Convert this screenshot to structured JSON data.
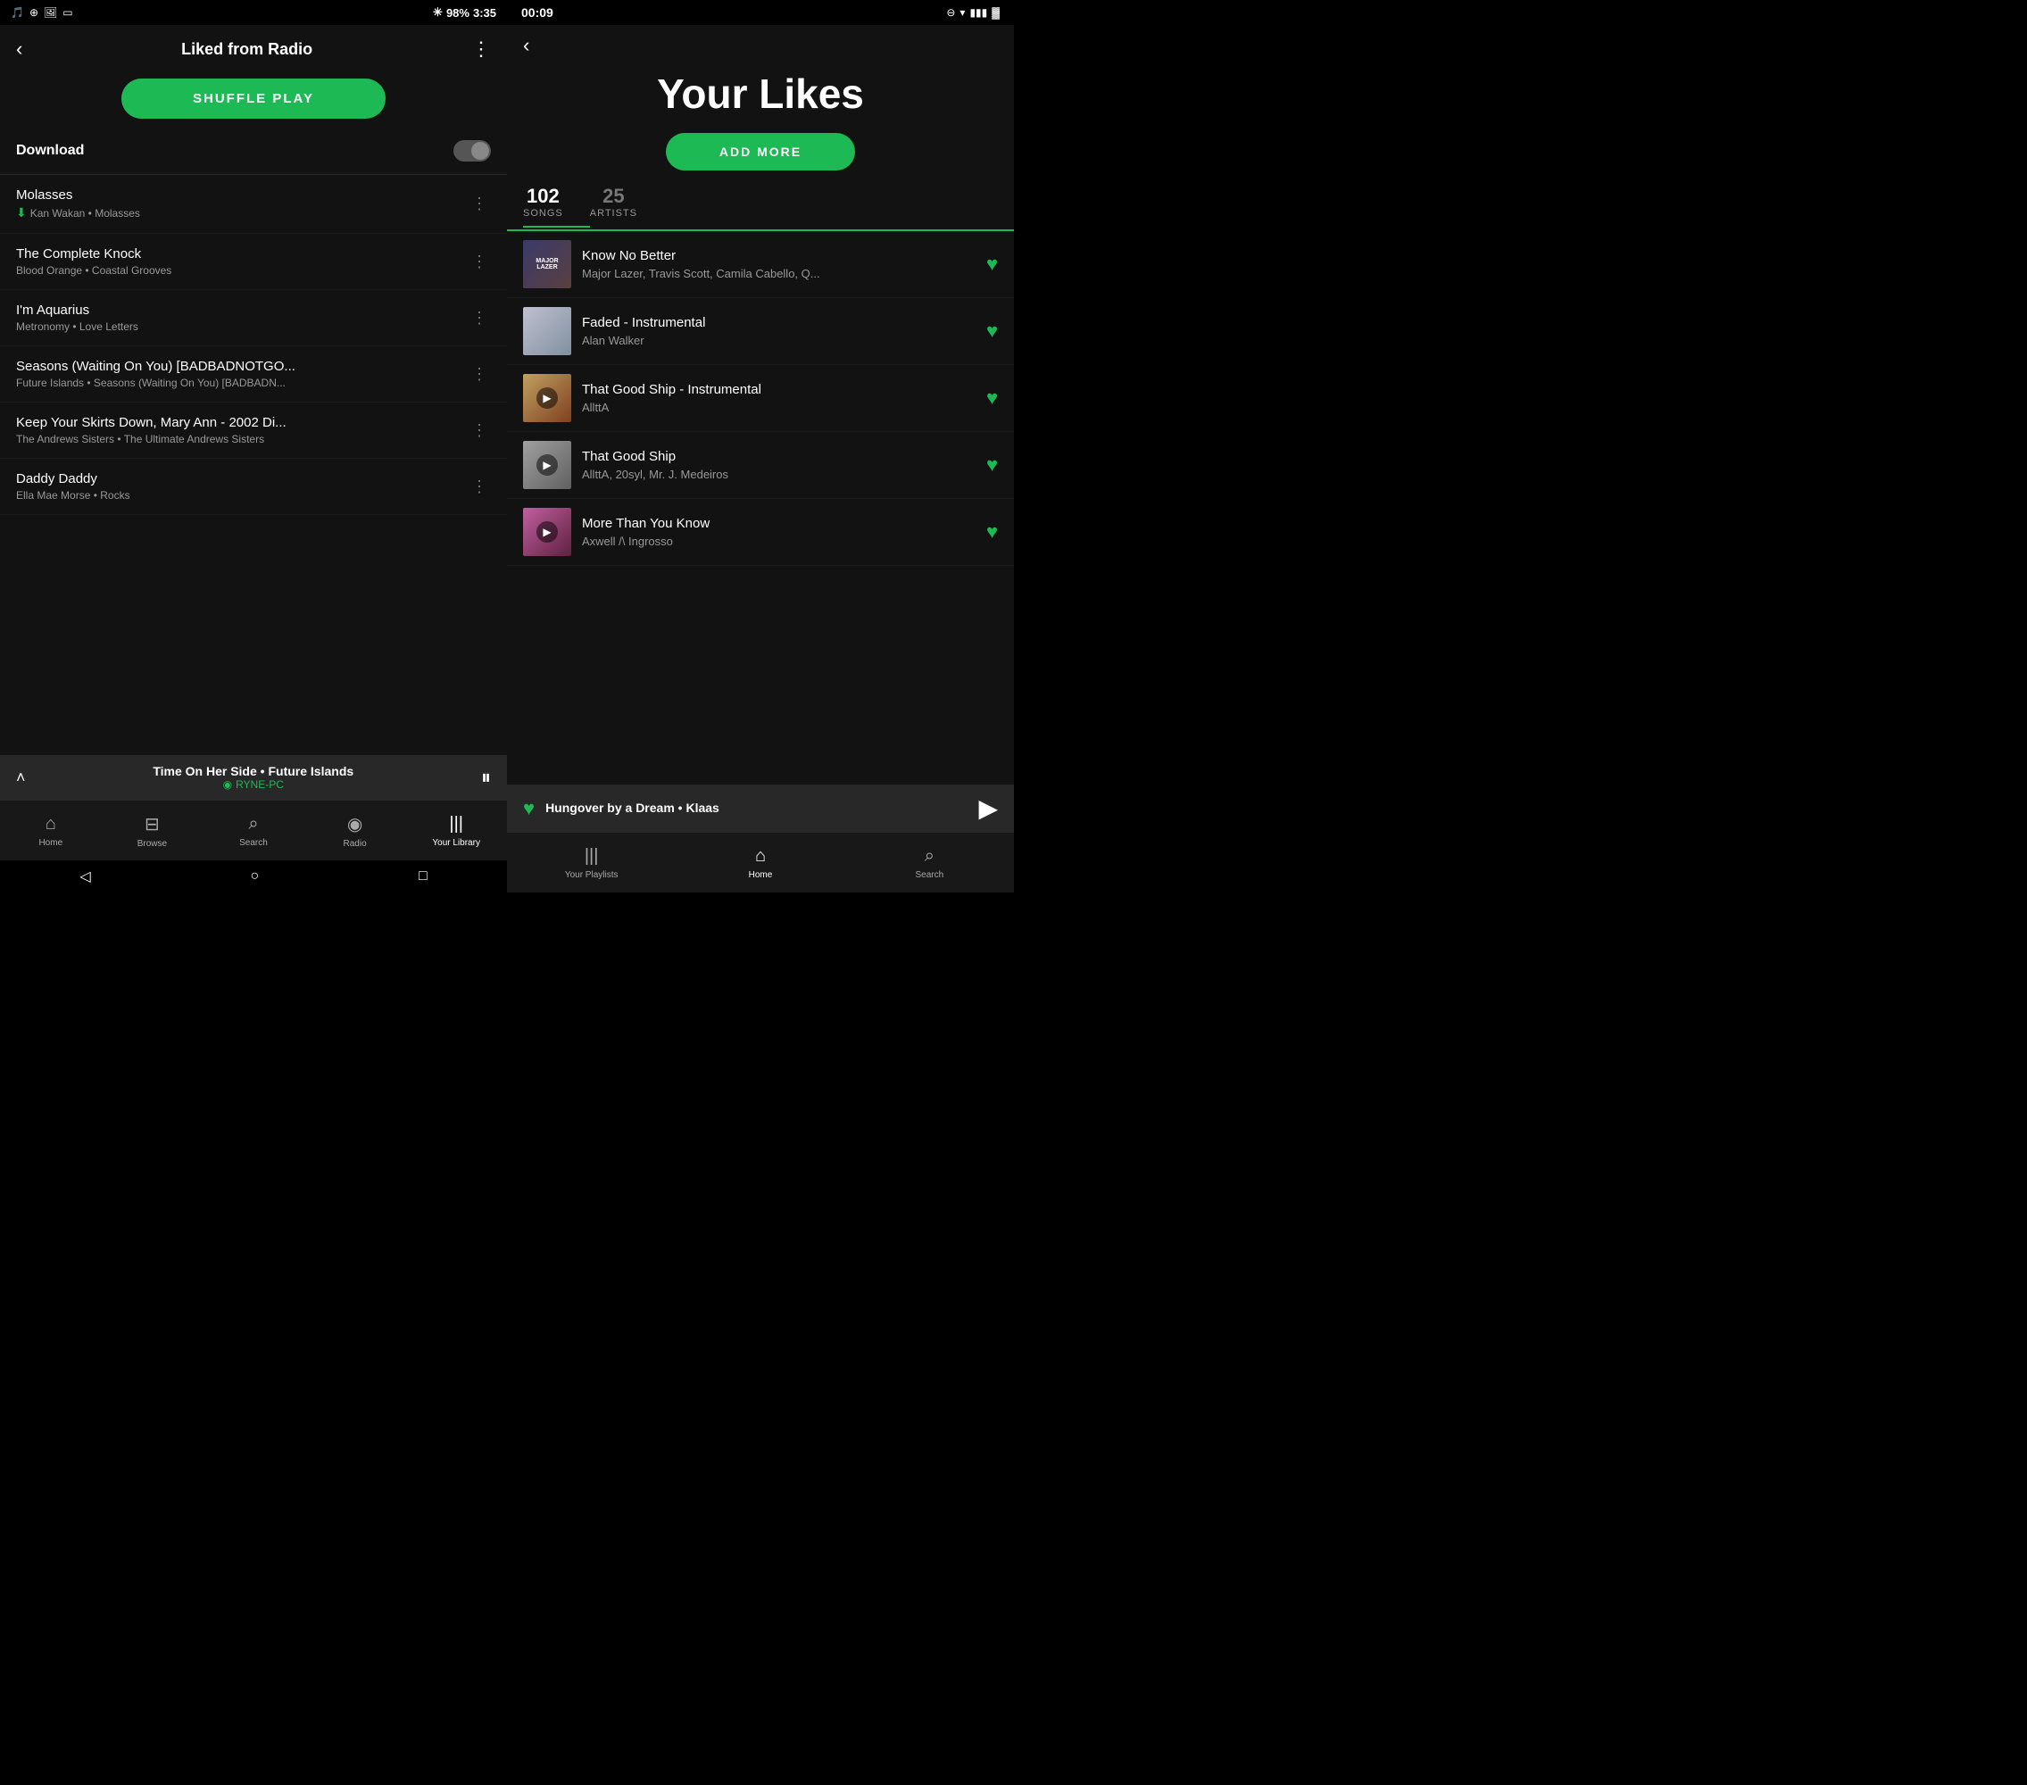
{
  "left": {
    "statusBar": {
      "time": "3:35",
      "battery": "98%"
    },
    "header": {
      "title": "Liked from Radio",
      "backLabel": "‹",
      "moreLabel": "⋮"
    },
    "shuffleBtn": "SHUFFLE PLAY",
    "download": {
      "label": "Download"
    },
    "songs": [
      {
        "title": "Molasses",
        "artist": "Kan Wakan",
        "album": "Molasses",
        "downloaded": true
      },
      {
        "title": "The Complete Knock",
        "artist": "Blood Orange",
        "album": "Coastal Grooves",
        "downloaded": false
      },
      {
        "title": "I'm Aquarius",
        "artist": "Metronomy",
        "album": "Love Letters",
        "downloaded": false
      },
      {
        "title": "Seasons (Waiting On You) [BADBADNOTGO...",
        "artist": "Future Islands",
        "album": "Seasons (Waiting On You) [BADBADN...",
        "downloaded": false
      },
      {
        "title": "Keep Your Skirts Down, Mary Ann - 2002 Di...",
        "artist": "The Andrews Sisters",
        "album": "The Ultimate Andrews Sisters",
        "downloaded": false
      },
      {
        "title": "Daddy Daddy",
        "artist": "Ella Mae Morse",
        "album": "Rocks",
        "downloaded": false
      }
    ],
    "nowPlaying": {
      "title": "Time On Her Side",
      "artist": "Future Islands",
      "device": "RYNE-PC"
    },
    "nav": [
      {
        "icon": "⌂",
        "label": "Home"
      },
      {
        "icon": "⊟",
        "label": "Browse"
      },
      {
        "icon": "⌕",
        "label": "Search"
      },
      {
        "icon": "◉",
        "label": "Radio"
      },
      {
        "icon": "|||",
        "label": "Your Library",
        "active": true
      }
    ]
  },
  "right": {
    "statusBar": {
      "time": "00:09"
    },
    "pageTitle": "Your Likes",
    "addMoreBtn": "ADD MORE",
    "stats": {
      "songs": {
        "count": "102",
        "label": "SONGS"
      },
      "artists": {
        "count": "25",
        "label": "ARTISTS"
      }
    },
    "songs": [
      {
        "title": "Know No Better",
        "artist": "Major Lazer, Travis Scott, Camila Cabello, Q...",
        "artClass": "art-1",
        "artText": "MAJOR LAZER"
      },
      {
        "title": "Faded - Instrumental",
        "artist": "Alan Walker",
        "artClass": "art-2",
        "artText": ""
      },
      {
        "title": "That Good Ship - Instrumental",
        "artist": "AllttA",
        "artClass": "art-3",
        "artText": ""
      },
      {
        "title": "That Good Ship",
        "artist": "AllttA, 20syl, Mr. J. Medeiros",
        "artClass": "art-4",
        "artText": ""
      },
      {
        "title": "More Than You Know",
        "artist": "Axwell /\\ Ingrosso",
        "artClass": "art-5",
        "artText": ""
      }
    ],
    "miniPlayer": {
      "title": "Hungover by a Dream",
      "artist": "Klaas"
    },
    "nav": [
      {
        "icon": "|||",
        "label": "Your Playlists"
      },
      {
        "icon": "⌂",
        "label": "Home",
        "active": true
      },
      {
        "icon": "⌕",
        "label": "Search"
      }
    ]
  }
}
